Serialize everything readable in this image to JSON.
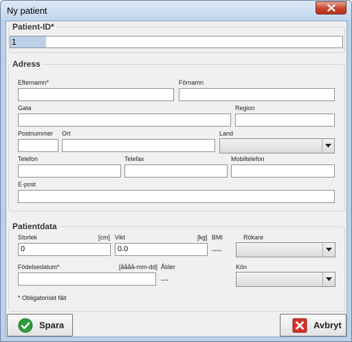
{
  "window": {
    "title": "Ny patient"
  },
  "patient_id": {
    "legend": "Patient-ID*",
    "value": "1"
  },
  "address": {
    "legend": "Adress",
    "efternamn_label": "Efternamn*",
    "fornamn_label": "Förnamn",
    "gata_label": "Gata",
    "region_label": "Region",
    "postnummer_label": "Postnummer",
    "ort_label": "Ort",
    "land_label": "Land",
    "telefon_label": "Telefon",
    "telefax_label": "Telefax",
    "mobiltelefon_label": "Mobiltelefon",
    "epost_label": "E-post"
  },
  "patientdata": {
    "legend": "Patientdata",
    "storlek_label": "Storlek",
    "storlek_unit": "[cm]",
    "storlek_value": "0",
    "vikt_label": "Vikt",
    "vikt_unit": "[kg]",
    "vikt_value": "0.0",
    "bmi_label": "BMI",
    "bmi_value": "----",
    "rokare_label": "Rökare",
    "fodelsedatum_label": "Födelsedatum*",
    "fodelsedatum_format": "[åååå-mm-dd]",
    "alder_label": "Ålder",
    "alder_value": "---",
    "kon_label": "Kön",
    "mandatory_note": "* Obligatoriskt fält"
  },
  "buttons": {
    "save": "Spara",
    "cancel": "Avbryt"
  },
  "icons": {
    "close": "close-icon",
    "save": "check-icon",
    "cancel": "cancel-icon"
  },
  "colors": {
    "close_button": "#c7432a",
    "save_icon": "#2e9e3a",
    "cancel_icon": "#d3312b"
  }
}
